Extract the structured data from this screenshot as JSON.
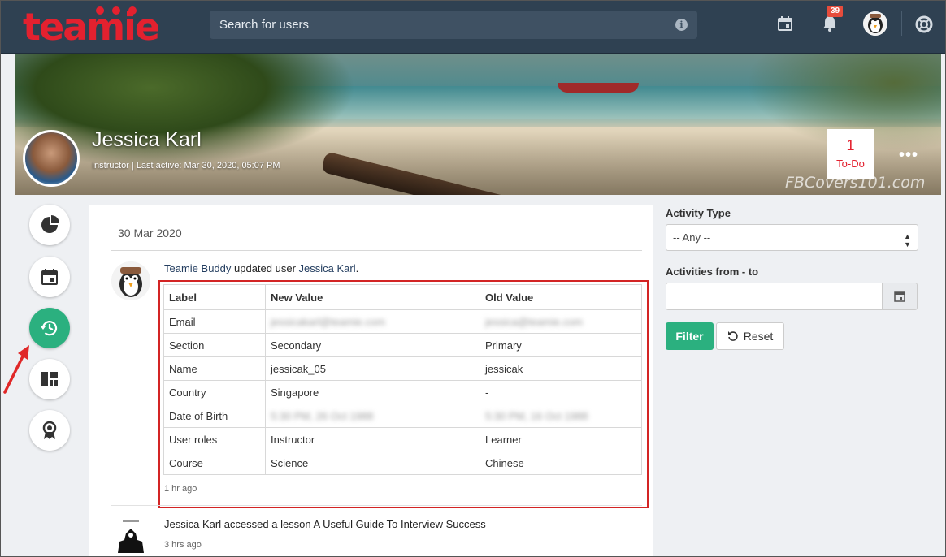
{
  "app": {
    "logo_text": "teamie"
  },
  "header": {
    "search_placeholder": "Search for users",
    "notification_count": "39",
    "icons": [
      "info-icon",
      "calendar-icon",
      "bell-icon",
      "avatar",
      "help-icon"
    ]
  },
  "profile": {
    "name": "Jessica Karl",
    "meta": "Instructor | Last active: Mar 30, 2020, 05:07 PM",
    "todo_count": "1",
    "todo_label": "To-Do",
    "more_label": "•••",
    "watermark": "FBCovers101.com"
  },
  "sidenav": {
    "items": [
      {
        "name": "pie-chart-icon",
        "active": false
      },
      {
        "name": "calendar-icon",
        "active": false
      },
      {
        "name": "history-icon",
        "active": true
      },
      {
        "name": "dashboard-icon",
        "active": false
      },
      {
        "name": "badge-icon",
        "active": false
      }
    ]
  },
  "feed": {
    "date": "30 Mar 2020",
    "entry1": {
      "actor": "Teamie Buddy",
      "verb": " updated user ",
      "target": "Jessica Karl",
      "suffix": ".",
      "time": "1 hr ago",
      "table": {
        "headers": [
          "Label",
          "New Value",
          "Old Value"
        ],
        "rows": [
          {
            "label": "Email",
            "new": "jessicakarl@teamie.com",
            "old": "jessica@teamie.com",
            "blurred": true,
            "new_suffix": ".com",
            "old_suffix": "com"
          },
          {
            "label": "Section",
            "new": "Secondary",
            "old": "Primary"
          },
          {
            "label": "Name",
            "new": "jessicak_05",
            "old": "jessicak"
          },
          {
            "label": "Country",
            "new": "Singapore",
            "old": "-"
          },
          {
            "label": "Date of Birth",
            "new": "5:30 PM, 26 Oct 1988",
            "old": "5:30 PM, 16 Oct 1988",
            "blurred": true
          },
          {
            "label": "User roles",
            "new": "Instructor",
            "old": "Learner"
          },
          {
            "label": "Course",
            "new": "Science",
            "old": "Chinese"
          }
        ]
      }
    },
    "entry2": {
      "actor": "Jessica Karl",
      "verb": " accessed a lesson ",
      "target": "A Useful Guide To Interview Success",
      "time": "3 hrs ago"
    }
  },
  "filters": {
    "activity_type_label": "Activity Type",
    "activity_type_value": "-- Any --",
    "date_range_label": "Activities from - to",
    "date_range_value": "",
    "filter_button": "Filter",
    "reset_button": "Reset"
  },
  "colors": {
    "accent": "#2bb07f",
    "brand": "#e3212f",
    "topbar": "#2f4152",
    "highlight_border": "#d32424"
  }
}
